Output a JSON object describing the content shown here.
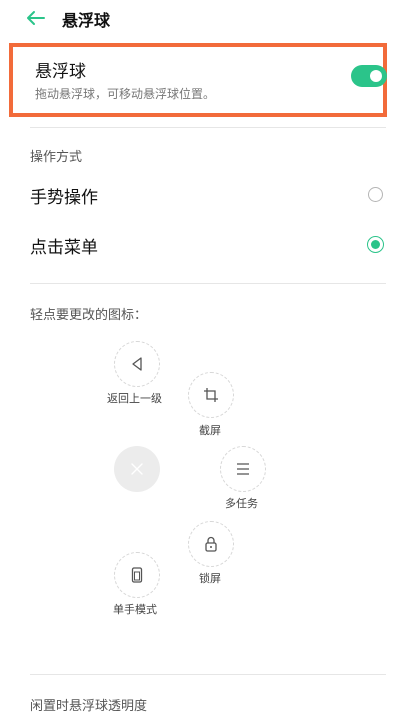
{
  "header": {
    "title": "悬浮球"
  },
  "floating_ball_row": {
    "title": "悬浮球",
    "description": "拖动悬浮球，可移动悬浮球位置。",
    "enabled": true
  },
  "operation_section": {
    "label": "操作方式",
    "options": [
      {
        "label": "手势操作",
        "selected": false
      },
      {
        "label": "点击菜单",
        "selected": true
      }
    ]
  },
  "icons_section": {
    "label": "轻点要更改的图标：",
    "items": [
      {
        "label": "返回上一级",
        "icon": "back-triangle-icon"
      },
      {
        "label": "截屏",
        "icon": "crop-icon"
      },
      {
        "label": "多任务",
        "icon": "menu-lines-icon"
      },
      {
        "label": "锁屏",
        "icon": "lock-icon"
      },
      {
        "label": "单手模式",
        "icon": "phone-icon"
      }
    ],
    "center_icon": "close-icon"
  },
  "opacity_section": {
    "label": "闲置时悬浮球透明度"
  },
  "colors": {
    "accent": "#2bc48a",
    "highlight_border": "#f26b3a"
  }
}
